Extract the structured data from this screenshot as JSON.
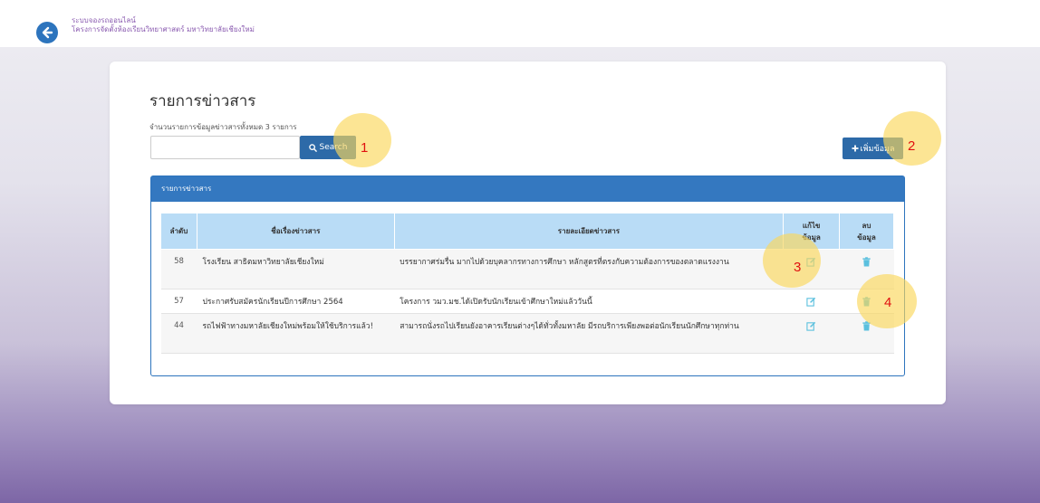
{
  "header": {
    "line1": "ระบบจองรถออนไลน์",
    "line2": "โครงการจัดตั้งห้องเรียนวิทยาศาสตร์ มหาวิทยาลัยเชียงใหม่"
  },
  "page": {
    "title": "รายการข่าวสาร",
    "count_text": "จำนวนรายการข้อมูลข่าวสารทั้งหมด 3 รายการ"
  },
  "search": {
    "placeholder": "",
    "button_label": "Search"
  },
  "add_button_label": "เพิ่มข้อมูล",
  "panel_title": "รายการข่าวสาร",
  "table": {
    "headers": {
      "no": "ลำดับ",
      "title": "ชื่อเรื่องข่าวสาร",
      "detail": "รายละเอียดข่าวสาร",
      "edit_line1": "แก้ไข",
      "edit_line2": "ข้อมูล",
      "delete_line1": "ลบ",
      "delete_line2": "ข้อมูล"
    },
    "rows": [
      {
        "no": "58",
        "title": "โรงเรียน สาธิตมหาวิทยาลัยเชียงใหม่",
        "detail": "บรรยากาศร่มรื่น มากไปด้วยบุคลากรทางการศึกษา หลักสูตรที่ตรงกับความต้องการของตลาดแรงงาน"
      },
      {
        "no": "57",
        "title": "ประกาศรับสมัครนักเรียนปีการศึกษา 2564",
        "detail": "โครงการ วมว.มช.ได้เปิดรับนักเรียนเข้าศึกษาใหม่แล้ววันนี้"
      },
      {
        "no": "44",
        "title": "รถไฟฟ้าทางมหาลัยเชียงใหม่พร้อมให้ใช้บริการแล้ว!",
        "detail": "สามารถนั่งรถไปเรียนยังอาคารเรียนต่างๆได้ทั่วทั้งมหาลัย มีรถบริการเพียงพอต่อนักเรียนนักศึกษาทุกท่าน"
      }
    ]
  },
  "markers": {
    "m1": "1",
    "m2": "2",
    "m3": "3",
    "m4": "4"
  },
  "icons": {
    "back": "arrow-left-circle-icon",
    "search": "magnifier-icon",
    "add": "plus-icon",
    "edit": "pencil-square-icon",
    "delete": "trash-icon"
  },
  "colors": {
    "primary": "#2d6aa8",
    "panel_header": "#3478c0",
    "table_header": "#b9dcf6",
    "icon": "#5bc0de",
    "marker": "#fad75a",
    "marker_number": "#e01010",
    "brand_text": "#8a5bb0"
  }
}
